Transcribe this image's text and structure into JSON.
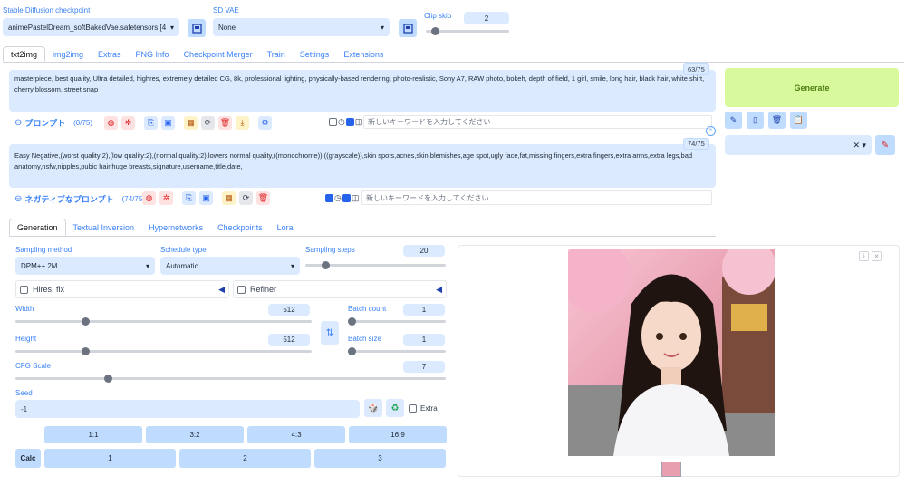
{
  "checkpoint": {
    "label": "Stable Diffusion checkpoint",
    "value": "animePastelDream_softBakedVae.safetensors [4"
  },
  "vae": {
    "label": "SD VAE",
    "value": "None"
  },
  "clip": {
    "label": "Clip skip",
    "value": "2"
  },
  "tabs": [
    "txt2img",
    "img2img",
    "Extras",
    "PNG Info",
    "Checkpoint Merger",
    "Train",
    "Settings",
    "Extensions"
  ],
  "prompt": {
    "text": "masterpiece, best quality, Ultra detailed, highres, extremely detailed CG, 8k, professional lighting, physically-based rendering, photo-realistic, Sony A7, RAW photo, bokeh, depth of field, 1 girl, smile, long hair, black hair, white shirt, cherry blossom, street snap",
    "counter": "63/75",
    "title": "プロンプト",
    "count": "(0/75)",
    "kw_placeholder": "新しいキーワードを入力してください"
  },
  "neg": {
    "text": "Easy Negative,(worst quality:2),(low quality:2),(normal quality:2),lowers normal quality,((monochrome)),((grayscale)),skin spots,acnes,skin blemishes,age spot,ugly face,fat,missing fingers,extra fingers,extra arms,extra legs,bad anatomy,nsfw,nipples,pubic hair,huge breasts,signature,username,title,date,",
    "counter": "74/75",
    "title": "ネガティブなプロンプト",
    "count": "(74/75)",
    "kw_placeholder": "新しいキーワードを入力してください"
  },
  "generate": "Generate",
  "subtabs": [
    "Generation",
    "Textual Inversion",
    "Hypernetworks",
    "Checkpoints",
    "Lora"
  ],
  "sampling": {
    "method_label": "Sampling method",
    "method": "DPM++ 2M",
    "schedule_label": "Schedule type",
    "schedule": "Automatic",
    "steps_label": "Sampling steps",
    "steps": "20",
    "steps_fraction": 0.15
  },
  "hires": "Hires. fix",
  "refiner": "Refiner",
  "width": {
    "label": "Width",
    "value": "512",
    "fraction": 0.24
  },
  "height": {
    "label": "Height",
    "value": "512",
    "fraction": 0.24
  },
  "batch_count": {
    "label": "Batch count",
    "value": "1",
    "fraction": 0.0
  },
  "batch_size": {
    "label": "Batch size",
    "value": "1",
    "fraction": 0.0
  },
  "cfg": {
    "label": "CFG Scale",
    "value": "7",
    "fraction": 0.2
  },
  "seed": {
    "label": "Seed",
    "value": "-1",
    "extra": "Extra"
  },
  "ratios": [
    "1:1",
    "3:2",
    "4:3",
    "16:9"
  ],
  "calc": "Calc",
  "nums": [
    "1",
    "2",
    "3"
  ],
  "colors": {
    "accent": "#3b82f6",
    "generate_bg": "#d9f99d",
    "field_bg": "#dbeafe"
  }
}
